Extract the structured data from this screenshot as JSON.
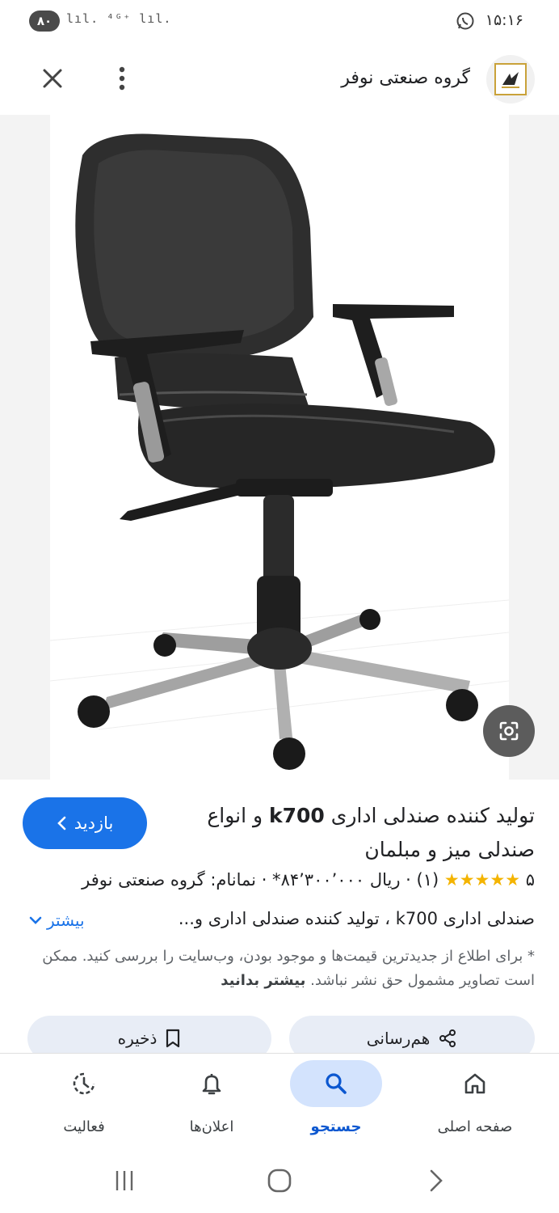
{
  "status_bar": {
    "time": "۱۵:۱۶",
    "battery": "۸۰",
    "signal_text": "lıl. ⁴ᴳ⁺ lıl."
  },
  "header": {
    "site_name": "گروه صنعتی نوفر",
    "close_icon": "close-icon",
    "more_icon": "more-vert-icon"
  },
  "result": {
    "title_pre": "تولید کننده صندلی اداری ",
    "title_model": "k700",
    "title_post": " و انواع صندلی میز و مبلمان",
    "visit_label": "بازدید",
    "rating_value": "۵",
    "stars": "★★★★★",
    "review_count": "(۱)",
    "price": "· ریال ۸۴٬۳۰۰٬۰۰۰* · نمانام: گروه صنعتی نوفر",
    "description": "صندلی اداری k700 ، تولید کننده صندلی اداری و...",
    "more_label": "بیشتر",
    "note": "* برای اطلاع از جدیدترین قیمت‌ها و موجود بودن، وب‌سایت را بررسی کنید. ممکن است تصاویر مشمول حق نشر نباشد.",
    "note_link": "بیشتر بدانید",
    "share_label": "هم‌رسانی",
    "save_label": "ذخیره"
  },
  "bottom_nav": {
    "items": [
      {
        "label": "صفحه اصلی",
        "icon": "home-icon"
      },
      {
        "label": "جستجو",
        "icon": "search-icon",
        "active": true
      },
      {
        "label": "اعلان‌ها",
        "icon": "bell-icon"
      },
      {
        "label": "فعالیت",
        "icon": "activity-icon"
      }
    ]
  },
  "colors": {
    "accent": "#1a73e8",
    "star": "#f4b400",
    "nav_active_bg": "#d3e3fd"
  }
}
